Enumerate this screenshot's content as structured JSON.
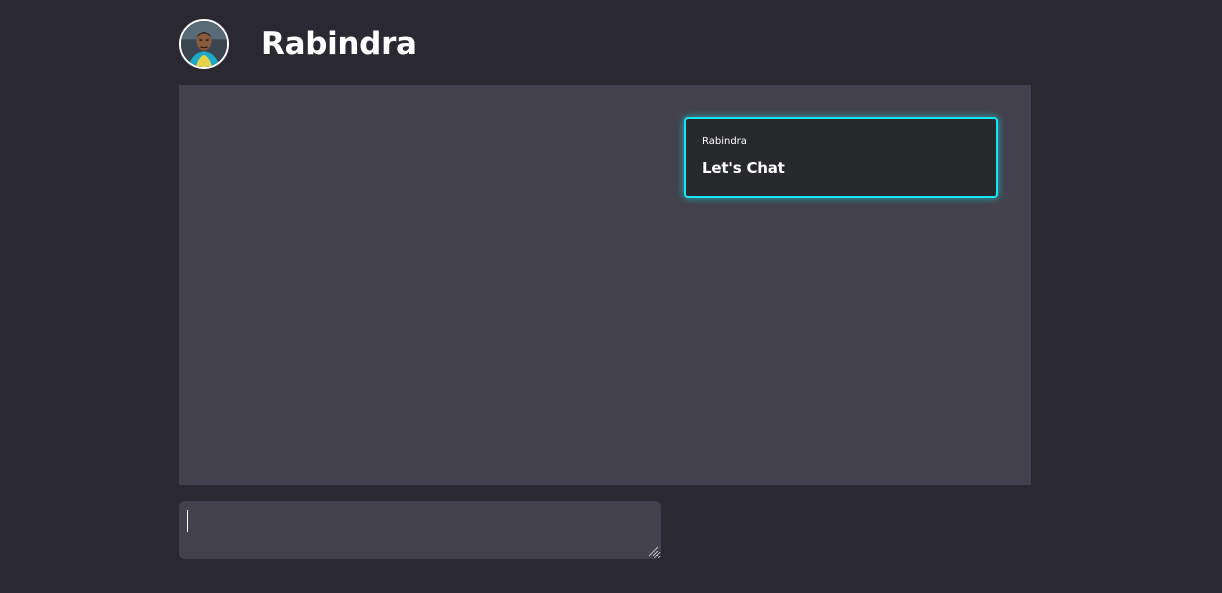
{
  "header": {
    "name": "Rabindra",
    "avatar_icon": "user-avatar"
  },
  "chat": {
    "messages": [
      {
        "sender": "Rabindra",
        "text": "Let's Chat"
      }
    ]
  },
  "composer": {
    "value": "",
    "placeholder": ""
  },
  "colors": {
    "background": "#2a2932",
    "panel": "#43414d",
    "bubble": "#28292d",
    "accent": "#16e6f2"
  }
}
